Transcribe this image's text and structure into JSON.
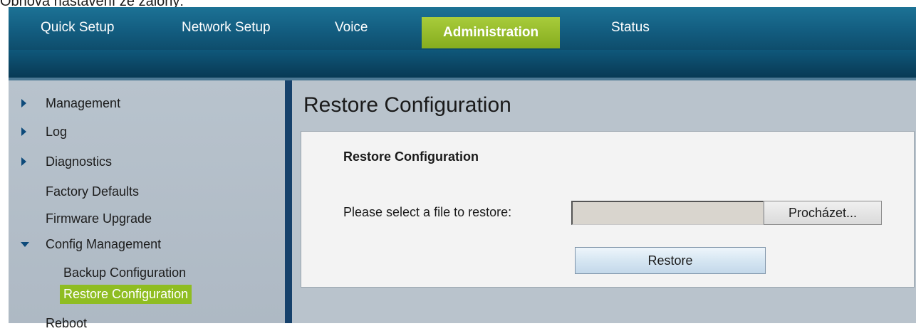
{
  "caption": "Obnova nastavení ze zálohy:",
  "nav": {
    "items": [
      {
        "label": "Quick Setup",
        "active": false
      },
      {
        "label": "Network Setup",
        "active": false
      },
      {
        "label": "Voice",
        "active": false
      },
      {
        "label": "Administration",
        "active": true
      },
      {
        "label": "Status",
        "active": false
      }
    ],
    "active_color": "#96bd2a"
  },
  "sidebar": {
    "items": [
      {
        "label": "Management",
        "icon": "chevron-right-icon"
      },
      {
        "label": "Log",
        "icon": "chevron-right-icon"
      },
      {
        "label": "Diagnostics",
        "icon": "chevron-right-icon"
      },
      {
        "label": "Factory Defaults",
        "icon": ""
      },
      {
        "label": "Firmware Upgrade",
        "icon": ""
      },
      {
        "label": "Config Management",
        "icon": "chevron-down-icon"
      },
      {
        "label": "Backup Configuration",
        "icon": "",
        "sub": true
      },
      {
        "label": "Restore Configuration",
        "icon": "",
        "sub": true,
        "active": true
      },
      {
        "label": "Reboot",
        "icon": ""
      }
    ],
    "active_color": "#8fbd22"
  },
  "main": {
    "title": "Restore Configuration",
    "panel": {
      "heading": "Restore Configuration",
      "file_label": "Please select a file to restore:",
      "file_value": "",
      "browse_label": "Procházet...",
      "restore_label": "Restore"
    }
  }
}
